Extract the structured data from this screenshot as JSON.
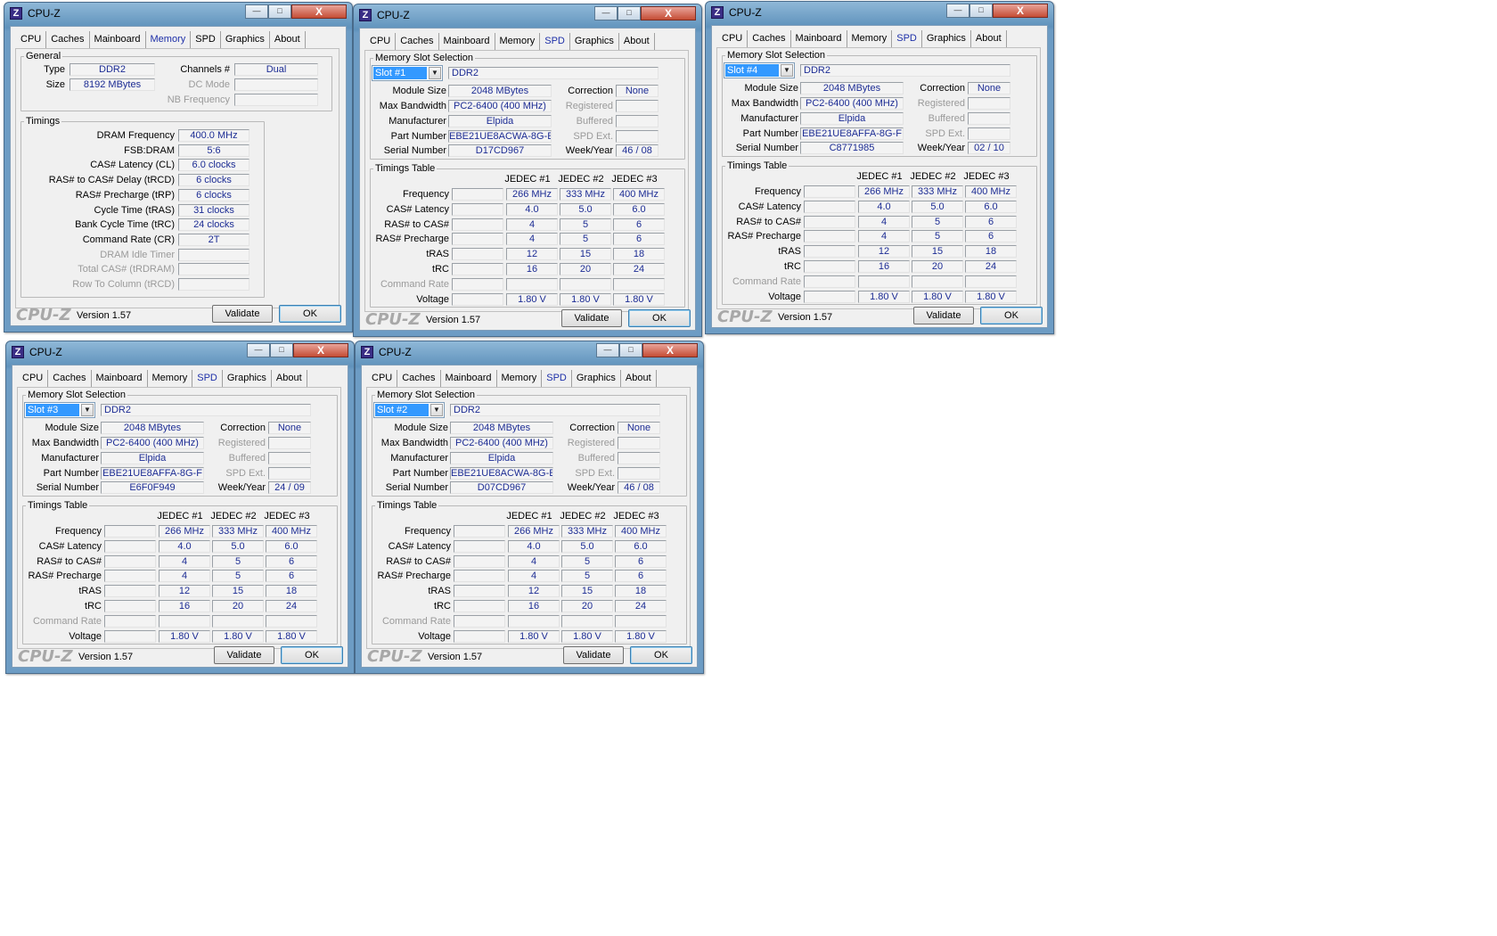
{
  "app_title": "CPU-Z",
  "app_icon_letter": "Z",
  "tabs": [
    "CPU",
    "Caches",
    "Mainboard",
    "Memory",
    "SPD",
    "Graphics",
    "About"
  ],
  "footer": {
    "logo": "CPU-Z",
    "version": "Version 1.57",
    "validate": "Validate",
    "ok": "OK"
  },
  "title_buttons": {
    "minimize": "—",
    "maximize": "□",
    "close": "X"
  },
  "memory_window": {
    "active_tab": "Memory",
    "general": {
      "legend": "General",
      "type_label": "Type",
      "type": "DDR2",
      "size_label": "Size",
      "size": "8192 MBytes",
      "channels_label": "Channels #",
      "channels": "Dual",
      "dc_mode_label": "DC Mode",
      "dc_mode": "",
      "nb_freq_label": "NB Frequency",
      "nb_freq": ""
    },
    "timings": {
      "legend": "Timings",
      "rows": [
        {
          "label": "DRAM Frequency",
          "value": "400.0 MHz",
          "enabled": true
        },
        {
          "label": "FSB:DRAM",
          "value": "5:6",
          "enabled": true
        },
        {
          "label": "CAS# Latency (CL)",
          "value": "6.0 clocks",
          "enabled": true
        },
        {
          "label": "RAS# to CAS# Delay (tRCD)",
          "value": "6 clocks",
          "enabled": true
        },
        {
          "label": "RAS# Precharge (tRP)",
          "value": "6 clocks",
          "enabled": true
        },
        {
          "label": "Cycle Time (tRAS)",
          "value": "31 clocks",
          "enabled": true
        },
        {
          "label": "Bank Cycle Time (tRC)",
          "value": "24 clocks",
          "enabled": true
        },
        {
          "label": "Command Rate (CR)",
          "value": "2T",
          "enabled": true
        },
        {
          "label": "DRAM Idle Timer",
          "value": "",
          "enabled": false
        },
        {
          "label": "Total CAS# (tRDRAM)",
          "value": "",
          "enabled": false
        },
        {
          "label": "Row To Column (tRCD)",
          "value": "",
          "enabled": false
        }
      ]
    }
  },
  "spd_labels": {
    "slot_legend": "Memory Slot Selection",
    "module_size": "Module Size",
    "max_bandwidth": "Max Bandwidth",
    "manufacturer": "Manufacturer",
    "part_number": "Part Number",
    "serial_number": "Serial Number",
    "correction": "Correction",
    "registered": "Registered",
    "buffered": "Buffered",
    "spd_ext": "SPD Ext.",
    "week_year": "Week/Year",
    "timings_legend": "Timings Table",
    "jedec_headers": [
      "JEDEC #1",
      "JEDEC #2",
      "JEDEC #3"
    ],
    "row_labels": [
      "Frequency",
      "CAS# Latency",
      "RAS# to CAS#",
      "RAS# Precharge",
      "tRAS",
      "tRC",
      "Command Rate",
      "Voltage"
    ]
  },
  "jedec_values": [
    [
      "266 MHz",
      "333 MHz",
      "400 MHz"
    ],
    [
      "4.0",
      "5.0",
      "6.0"
    ],
    [
      "4",
      "5",
      "6"
    ],
    [
      "4",
      "5",
      "6"
    ],
    [
      "12",
      "15",
      "18"
    ],
    [
      "16",
      "20",
      "24"
    ],
    [
      "",
      "",
      ""
    ],
    [
      "1.80 V",
      "1.80 V",
      "1.80 V"
    ]
  ],
  "spd_windows": [
    {
      "slot": "Slot #1",
      "type": "DDR2",
      "module_size": "2048 MBytes",
      "max_bandwidth": "PC2-6400 (400 MHz)",
      "manufacturer": "Elpida",
      "part_number": "EBE21UE8ACWA-8G-E",
      "serial_number": "D17CD967",
      "correction": "None",
      "week_year": "46 / 08"
    },
    {
      "slot": "Slot #4",
      "type": "DDR2",
      "module_size": "2048 MBytes",
      "max_bandwidth": "PC2-6400 (400 MHz)",
      "manufacturer": "Elpida",
      "part_number": "EBE21UE8AFFA-8G-F",
      "serial_number": "C8771985",
      "correction": "None",
      "week_year": "02 / 10"
    },
    {
      "slot": "Slot #3",
      "type": "DDR2",
      "module_size": "2048 MBytes",
      "max_bandwidth": "PC2-6400 (400 MHz)",
      "manufacturer": "Elpida",
      "part_number": "EBE21UE8AFFA-8G-F",
      "serial_number": "E6F0F949",
      "correction": "None",
      "week_year": "24 / 09"
    },
    {
      "slot": "Slot #2",
      "type": "DDR2",
      "module_size": "2048 MBytes",
      "max_bandwidth": "PC2-6400 (400 MHz)",
      "manufacturer": "Elpida",
      "part_number": "EBE21UE8ACWA-8G-E",
      "serial_number": "D07CD967",
      "correction": "None",
      "week_year": "46 / 08"
    }
  ]
}
